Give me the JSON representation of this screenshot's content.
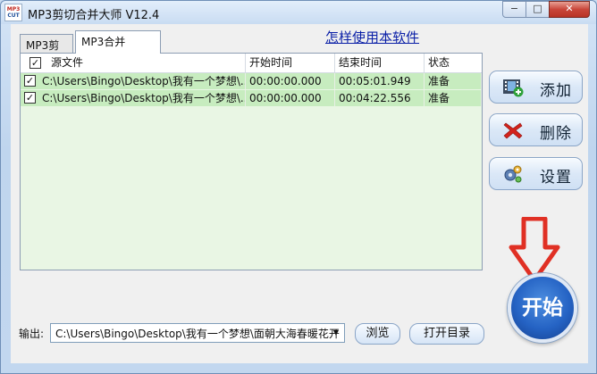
{
  "window": {
    "title": "MP3剪切合并大师 V12.4",
    "logo_top": "MP3",
    "logo_bottom": "CUT",
    "min_glyph": "−",
    "max_glyph": "□",
    "close_glyph": "✕"
  },
  "tabs": [
    {
      "label": "MP3剪切",
      "active": false
    },
    {
      "label": "MP3合并",
      "active": true
    }
  ],
  "help_link": "怎样使用本软件",
  "table": {
    "columns": [
      "源文件",
      "开始时间",
      "结束时间",
      "状态"
    ],
    "header_checked": true,
    "rows": [
      {
        "checked": true,
        "file": "C:\\Users\\Bingo\\Desktop\\我有一个梦想\\...",
        "start": "00:00:00.000",
        "end": "00:05:01.949",
        "status": "准备"
      },
      {
        "checked": true,
        "file": "C:\\Users\\Bingo\\Desktop\\我有一个梦想\\...",
        "start": "00:00:00.000",
        "end": "00:04:22.556",
        "status": "准备"
      }
    ]
  },
  "side_buttons": {
    "add": {
      "label": "添加",
      "icon": "film-add-icon"
    },
    "delete": {
      "label": "删除",
      "icon": "red-x-icon"
    },
    "settings": {
      "label": "设置",
      "icon": "gears-icon"
    }
  },
  "start_button": "开始",
  "output": {
    "label": "输出:",
    "value": "C:\\Users\\Bingo\\Desktop\\我有一个梦想\\面朝大海春暖花开",
    "browse": "浏览",
    "open_dir": "打开目录"
  },
  "colors": {
    "row_bg": "#c7ecbf",
    "list_bg": "#e9f6e4",
    "arrow_red": "#e03024",
    "start_blue": "#2563c4",
    "link_blue": "#0a1fa7"
  }
}
